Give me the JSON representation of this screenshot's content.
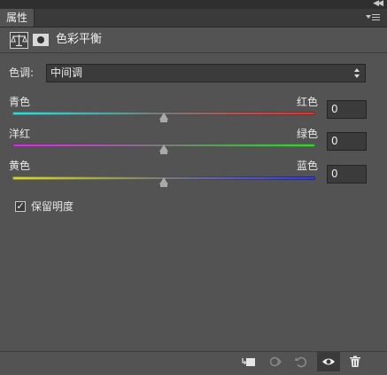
{
  "panel": {
    "tab_label": "属性",
    "title": "色彩平衡"
  },
  "tone": {
    "label": "色调:",
    "value": "中间调"
  },
  "sliders": [
    {
      "left_label": "青色",
      "right_label": "红色",
      "value": "0"
    },
    {
      "left_label": "洋红",
      "right_label": "绿色",
      "value": "0"
    },
    {
      "left_label": "黄色",
      "right_label": "蓝色",
      "value": "0"
    }
  ],
  "preserve_luminosity": {
    "label": "保留明度",
    "checked": true
  },
  "colors": {
    "cyan": "#3ad8d8",
    "red": "#d03a3a",
    "magenta": "#c83ad0",
    "green": "#3ad03a",
    "yellow": "#d8d83a",
    "blue": "#3a3ad8"
  },
  "footer_icons": [
    "clip-to-layer-icon",
    "view-previous-state-icon",
    "reset-icon",
    "visibility-eye-icon",
    "trash-icon"
  ],
  "header_icons": [
    "color-balance-adjustment-icon",
    "layer-mask-icon"
  ]
}
